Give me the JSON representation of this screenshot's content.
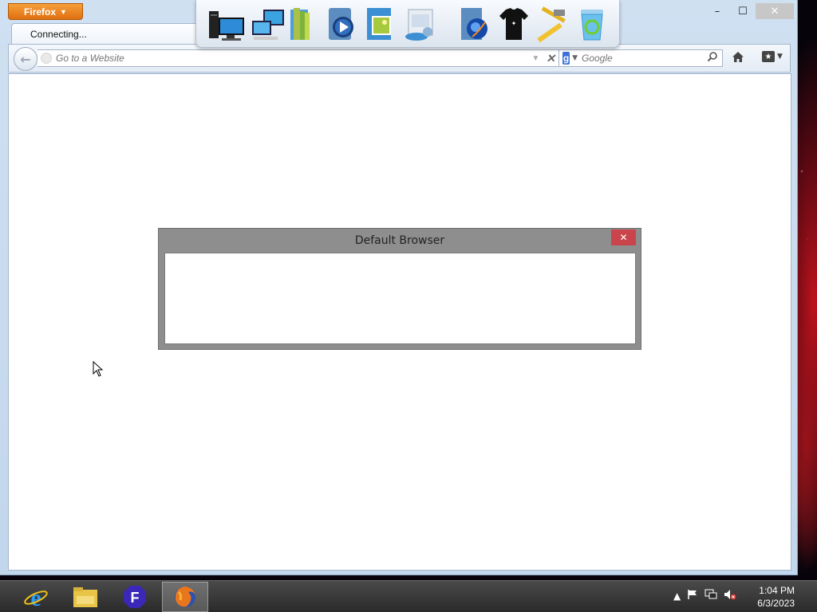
{
  "browser": {
    "menu_button": "Firefox",
    "tab_title": "Connecting...",
    "url_placeholder": "Go to a Website",
    "search_engine": "g",
    "search_placeholder": "Google",
    "win_minimize": "–",
    "win_maximize": "☐",
    "win_close": "✕"
  },
  "dock": {
    "icons": [
      "computer-icon",
      "network-icon",
      "library-icon",
      "media-player-icon",
      "pictures-icon",
      "control-panel-icon",
      "internet-globe-icon",
      "tshirt-icon",
      "tools-icon",
      "recycle-bin-icon"
    ]
  },
  "dialog": {
    "title": "Default Browser",
    "close": "✕"
  },
  "taskbar": {
    "items": [
      "internet-explorer-icon",
      "file-explorer-icon",
      "app-f-icon",
      "firefox-icon"
    ],
    "active_item": "firefox-icon",
    "time": "1:04 PM",
    "date": "6/3/2023",
    "tray_icons": [
      "show-hidden-icons-arrow",
      "action-center-flag-icon",
      "network-icon",
      "volume-muted-icon"
    ]
  },
  "colors": {
    "firefox_orange": "#e67e22",
    "dialog_close": "#c9454b",
    "dialog_bg": "#8e8e8e"
  }
}
